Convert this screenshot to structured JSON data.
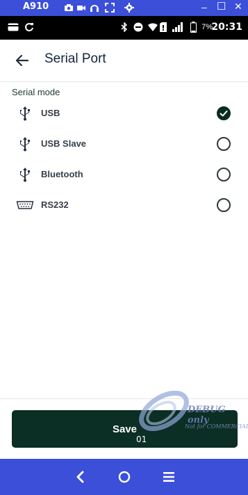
{
  "window": {
    "title": "A910"
  },
  "status_bar": {
    "battery": "7%",
    "time": "20:31"
  },
  "app_bar": {
    "title": "Serial Port"
  },
  "section": {
    "label": "Serial mode"
  },
  "options": [
    {
      "label": "USB",
      "icon": "usb-icon",
      "selected": true
    },
    {
      "label": "USB Slave",
      "icon": "usb-icon",
      "selected": false
    },
    {
      "label": "Bluetooth",
      "icon": "usb-icon",
      "selected": false
    },
    {
      "label": "RS232",
      "icon": "serial-port-icon",
      "selected": false
    }
  ],
  "save": {
    "label": "Save",
    "overlay_text": "01"
  },
  "watermark": {
    "debug": "DEBUG only",
    "note": "Not for COMMERCIAL"
  },
  "colors": {
    "accent": "#0b2e25",
    "window_bar": "#3b4fd9",
    "status_bar": "#000000"
  }
}
